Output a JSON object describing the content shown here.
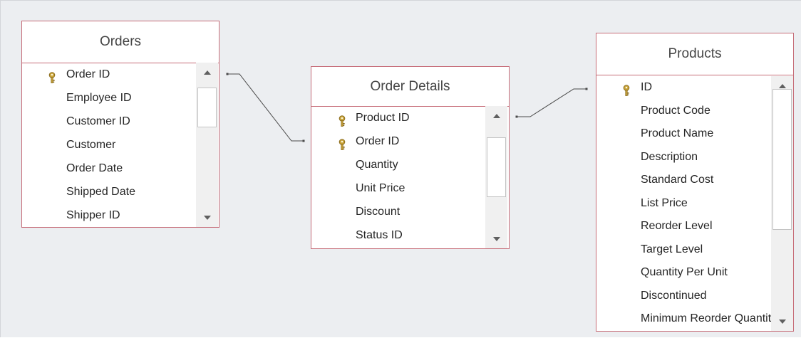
{
  "tables": [
    {
      "id": "orders",
      "title": "Orders",
      "fields": [
        {
          "name": "Order ID",
          "key": true
        },
        {
          "name": "Employee ID",
          "key": false
        },
        {
          "name": "Customer ID",
          "key": false
        },
        {
          "name": "Customer",
          "key": false
        },
        {
          "name": "Order Date",
          "key": false
        },
        {
          "name": "Shipped Date",
          "key": false
        },
        {
          "name": "Shipper ID",
          "key": false
        }
      ]
    },
    {
      "id": "order-details",
      "title": "Order Details",
      "fields": [
        {
          "name": "Product ID",
          "key": true
        },
        {
          "name": "Order ID",
          "key": true
        },
        {
          "name": "Quantity",
          "key": false
        },
        {
          "name": "Unit Price",
          "key": false
        },
        {
          "name": "Discount",
          "key": false
        },
        {
          "name": "Status ID",
          "key": false
        }
      ]
    },
    {
      "id": "products",
      "title": "Products",
      "fields": [
        {
          "name": "ID",
          "key": true
        },
        {
          "name": "Product Code",
          "key": false
        },
        {
          "name": "Product Name",
          "key": false
        },
        {
          "name": "Description",
          "key": false
        },
        {
          "name": "Standard Cost",
          "key": false
        },
        {
          "name": "List Price",
          "key": false
        },
        {
          "name": "Reorder Level",
          "key": false
        },
        {
          "name": "Target Level",
          "key": false
        },
        {
          "name": "Quantity Per Unit",
          "key": false
        },
        {
          "name": "Discontinued",
          "key": false
        },
        {
          "name": "Minimum Reorder Quantity",
          "key": false
        }
      ]
    }
  ],
  "relationships": [
    {
      "from_table": "orders",
      "from_field": "Order ID",
      "to_table": "order-details",
      "to_field": "Order ID"
    },
    {
      "from_table": "order-details",
      "from_field": "Product ID",
      "to_table": "products",
      "to_field": "ID"
    }
  ],
  "icons": {
    "primary_key": "key-icon",
    "scroll_up": "scroll-up-arrow-icon",
    "scroll_down": "scroll-down-arrow-icon"
  },
  "colors": {
    "canvas_background": "#eceef1",
    "table_border": "#c66c78",
    "title_text": "#444444",
    "field_text": "#262626",
    "relationship_line": "#4a4a4a",
    "key_icon_gold": "#c9a43a"
  }
}
